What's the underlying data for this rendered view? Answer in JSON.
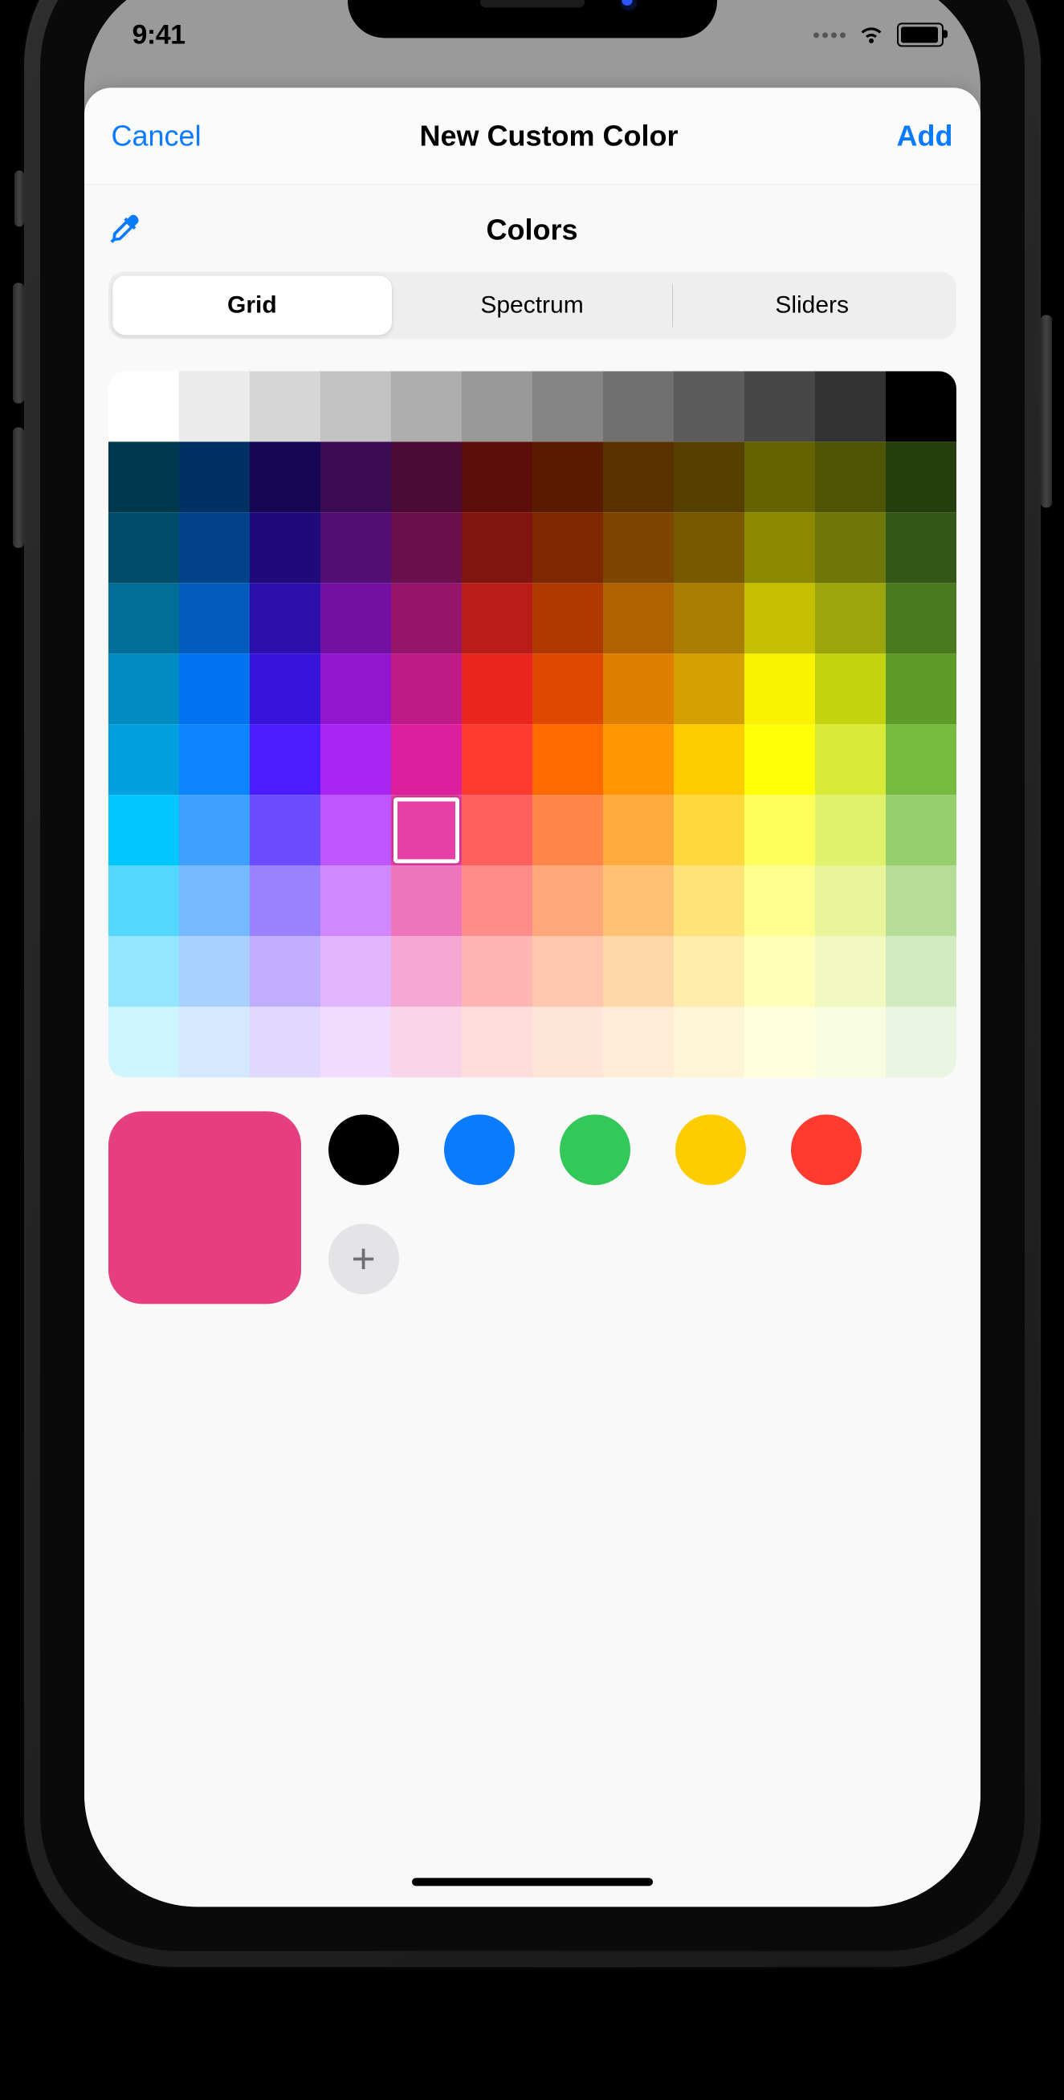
{
  "status": {
    "time": "9:41"
  },
  "nav": {
    "cancel": "Cancel",
    "title": "New Custom Color",
    "add": "Add"
  },
  "section_title": "Colors",
  "tabs": [
    "Grid",
    "Spectrum",
    "Sliders"
  ],
  "tab_selected": 0,
  "grid": {
    "cols": 12,
    "selected": {
      "row": 6,
      "col": 4
    },
    "rows": [
      [
        "#ffffff",
        "#ebebeb",
        "#d6d6d6",
        "#c2c2c2",
        "#adadad",
        "#999999",
        "#858585",
        "#707070",
        "#5c5c5c",
        "#474747",
        "#333333",
        "#000000"
      ],
      [
        "#00384d",
        "#003061",
        "#150654",
        "#3a0a52",
        "#4c0a36",
        "#5d0e0a",
        "#5a1c00",
        "#593200",
        "#564000",
        "#656200",
        "#4f5504",
        "#253e0e"
      ],
      [
        "#004d6b",
        "#004187",
        "#1f0a7a",
        "#520e74",
        "#6b0e4c",
        "#821410",
        "#7d2800",
        "#7c4600",
        "#785900",
        "#8c8900",
        "#6e7708",
        "#335716"
      ],
      [
        "#016e98",
        "#015bbd",
        "#2c10ad",
        "#730fa3",
        "#97146b",
        "#b81d17",
        "#af3900",
        "#af6300",
        "#a97d00",
        "#c4bf00",
        "#9aa60c",
        "#49791f"
      ],
      [
        "#008cc1",
        "#0074f0",
        "#3814db",
        "#9215d0",
        "#c01a88",
        "#e9251e",
        "#de4800",
        "#de7f00",
        "#d69f00",
        "#f9f200",
        "#c4d310",
        "#5e9a27"
      ],
      [
        "#00a1de",
        "#0c84ff",
        "#4b1cff",
        "#a726f2",
        "#de1f9d",
        "#ff3b30",
        "#ff6a00",
        "#ff9500",
        "#ffcc00",
        "#ffff0a",
        "#d8eb37",
        "#76bb40"
      ],
      [
        "#00c7ff",
        "#3fa1ff",
        "#6b4cff",
        "#be55ff",
        "#e63fa6",
        "#ff605d",
        "#ff8648",
        "#ffab3d",
        "#ffd83e",
        "#ffff5c",
        "#e0f16b",
        "#97cf6c"
      ],
      [
        "#53d7ff",
        "#75b9ff",
        "#9a81ff",
        "#d188ff",
        "#ef75bd",
        "#ff8c89",
        "#ffa87c",
        "#ffc173",
        "#ffe278",
        "#ffff8f",
        "#e9f598",
        "#b5dd98"
      ],
      [
        "#94e5ff",
        "#a8d1ff",
        "#c1aeff",
        "#e2b6ff",
        "#f5a8d4",
        "#ffb6b4",
        "#ffc7ae",
        "#ffd7a9",
        "#ffecac",
        "#ffffba",
        "#f1f9c1",
        "#d1eac0"
      ],
      [
        "#cef4ff",
        "#d4e9ff",
        "#e0d8ff",
        "#f1dcff",
        "#fad5ea",
        "#ffdddc",
        "#ffe4d8",
        "#ffecd6",
        "#fff6d7",
        "#ffffde",
        "#f8fce1",
        "#e9f5e1"
      ]
    ]
  },
  "current_color": "#e63f80",
  "presets": [
    "#000000",
    "#0a7aff",
    "#34c759",
    "#ffcc00",
    "#ff3b30"
  ],
  "add_preset_label": "+"
}
